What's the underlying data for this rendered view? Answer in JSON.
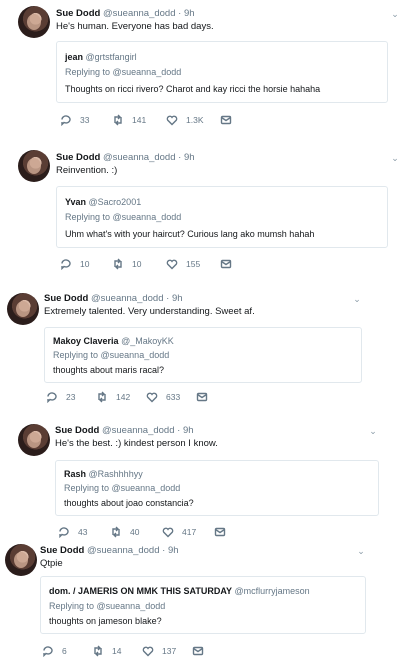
{
  "tweets": [
    {
      "name": "Sue Dodd",
      "meta": "@sueanna_dodd · 9h",
      "text": "He's human. Everyone has bad days.",
      "quote": {
        "name": "jean",
        "handle": "@grtstfangirl",
        "reply": "Replying to @sueanna_dodd",
        "text": "Thoughts on ricci rivero? Charot and kay ricci the horsie hahaha"
      },
      "replies": "33",
      "retweets": "141",
      "likes": "1.3K"
    },
    {
      "name": "Sue Dodd",
      "meta": "@sueanna_dodd · 9h",
      "text": "Reinvention. :)",
      "quote": {
        "name": "Yvan",
        "handle": "@Sacro2001",
        "reply": "Replying to @sueanna_dodd",
        "text": "Uhm what's with your haircut? Curious lang ako mumsh hahah"
      },
      "replies": "10",
      "retweets": "10",
      "likes": "155"
    },
    {
      "name": "Sue Dodd",
      "meta": "@sueanna_dodd · 9h",
      "text": "Extremely talented. Very understanding. Sweet af.",
      "quote": {
        "name": "Makoy Claveria",
        "handle": "@_MakoyKK",
        "reply": "Replying to @sueanna_dodd",
        "text": "thoughts about maris racal?"
      },
      "replies": "23",
      "retweets": "142",
      "likes": "633"
    },
    {
      "name": "Sue Dodd",
      "meta": "@sueanna_dodd · 9h",
      "text": "He's the best. :) kindest person I know.",
      "quote": {
        "name": "Rash",
        "handle": "@Rashhhhyy",
        "reply": "Replying to @sueanna_dodd",
        "text": "thoughts about joao constancia?"
      },
      "replies": "43",
      "retweets": "40",
      "likes": "417"
    },
    {
      "name": "Sue Dodd",
      "meta": "@sueanna_dodd · 9h",
      "text": "Qtpie",
      "quote": {
        "name": "dom. / JAMERIS ON MMK THIS SATURDAY",
        "handle": "@mcflurryjameson",
        "reply": "Replying to @sueanna_dodd",
        "text": "thoughts on jameson blake?"
      },
      "replies": "6",
      "retweets": "14",
      "likes": "137"
    }
  ],
  "icons": {
    "reply": "reply-icon",
    "retweet": "retweet-icon",
    "like": "heart-icon",
    "dm": "direct-message-icon",
    "caret": "chevron-down-icon"
  },
  "colors": {
    "text": "#14171a",
    "secondary": "#657786",
    "border": "#e1e8ed"
  }
}
